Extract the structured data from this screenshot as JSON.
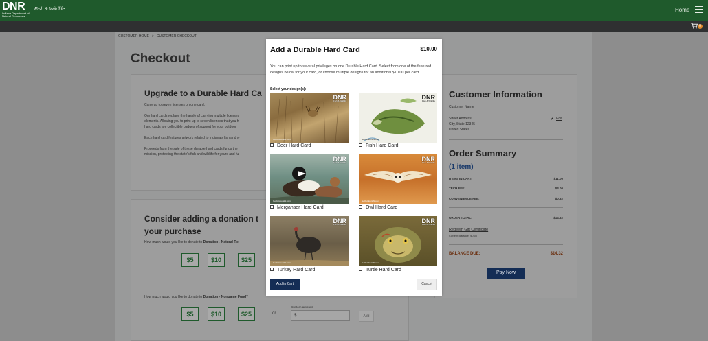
{
  "header": {
    "logo_big": "DNR",
    "logo_small": "Indiana Department of Natural Resources",
    "logo_sub": "Fish & Wildlife",
    "nav_home": "Home",
    "cart_count": "0"
  },
  "breadcrumb": {
    "home": "CUSTOMER HOME",
    "separator": ">",
    "current": "CUSTOMER CHECKOUT"
  },
  "page_title": "Checkout",
  "upgrade": {
    "title": "Upgrade to a Durable Hard Ca",
    "line1": "Carry up to seven licenses on one card.",
    "para2_l1": "Our hard cards replace the hassle of carrying multiple licenses",
    "para2_l2": "elements. Allowing you to print up to seven licenses that you h",
    "para2_l3": "hard cards are collectible badges of support for your outdoor",
    "para3": "Each hard card features artwork related to Indiana's fish and w",
    "para4_l1": "Proceeds from the sale of these durable hard cards funds the",
    "para4_l2": "mission, protecting the state's fish and wildlife for yours and fu"
  },
  "donation": {
    "title_l1": "Consider adding a donation t",
    "title_l2": "your purchase",
    "q1_prefix": "How much would you like to donate to ",
    "q1_bold": "Donation - Natural Re",
    "q2_prefix": "How much would you like to donate to ",
    "q2_bold": "Donation - Nongame Fund",
    "q2_suffix": "?",
    "amounts": [
      "$5",
      "$10",
      "$25"
    ],
    "or": "or",
    "custom_label": "Custom amount",
    "dollar": "$",
    "add": "Add"
  },
  "customer": {
    "title": "Customer Information",
    "name": "Customer Name",
    "street": "Street Address",
    "city": "City, State  12345",
    "country": "United States",
    "edit": "Edit"
  },
  "summary": {
    "title": "Order Summary",
    "count": "(1 item)",
    "rows": [
      {
        "label": "ITEMS IN CART:",
        "value": "$11.00"
      },
      {
        "label": "TECH FEE:",
        "value": "$3.00"
      },
      {
        "label": "CONVENIENCE FEE:",
        "value": "$0.32"
      }
    ],
    "total_label": "ORDER TOTAL:",
    "total_value": "$14.32",
    "redeem": "Redeem Gift Certificate",
    "balance_small": "Current Balance: $0.00",
    "due_label": "BALANCE DUE:",
    "due_value": "$14.32",
    "pay": "Pay Now"
  },
  "modal": {
    "title": "Add a Durable Hard Card",
    "price": "$10.00",
    "desc": "You can print up to several privileges on one Durable Hard Card. Select from one of the featured designs below for your card, or choose multiple designs for an additional $10.00 per card.",
    "select_label": "Select your design(s):",
    "brand": "DNR",
    "brand_small": "Fish & Wildlife",
    "url": "GoOutdoorsIN.com",
    "cards": [
      {
        "label": "Deer Hard Card"
      },
      {
        "label": "Fish Hard Card"
      },
      {
        "label": "Merganser Hard Card"
      },
      {
        "label": "Owl Hard Card"
      },
      {
        "label": "Turkey Hard Card"
      },
      {
        "label": "Turtle Hard Card"
      }
    ],
    "add_to_cart": "Add to Cart",
    "cancel": "Cancel"
  },
  "colors": {
    "brand_green": "#1f5a2c",
    "navy": "#142d55",
    "balance_due": "#6b2f0f",
    "cart_badge": "#e0892b"
  }
}
